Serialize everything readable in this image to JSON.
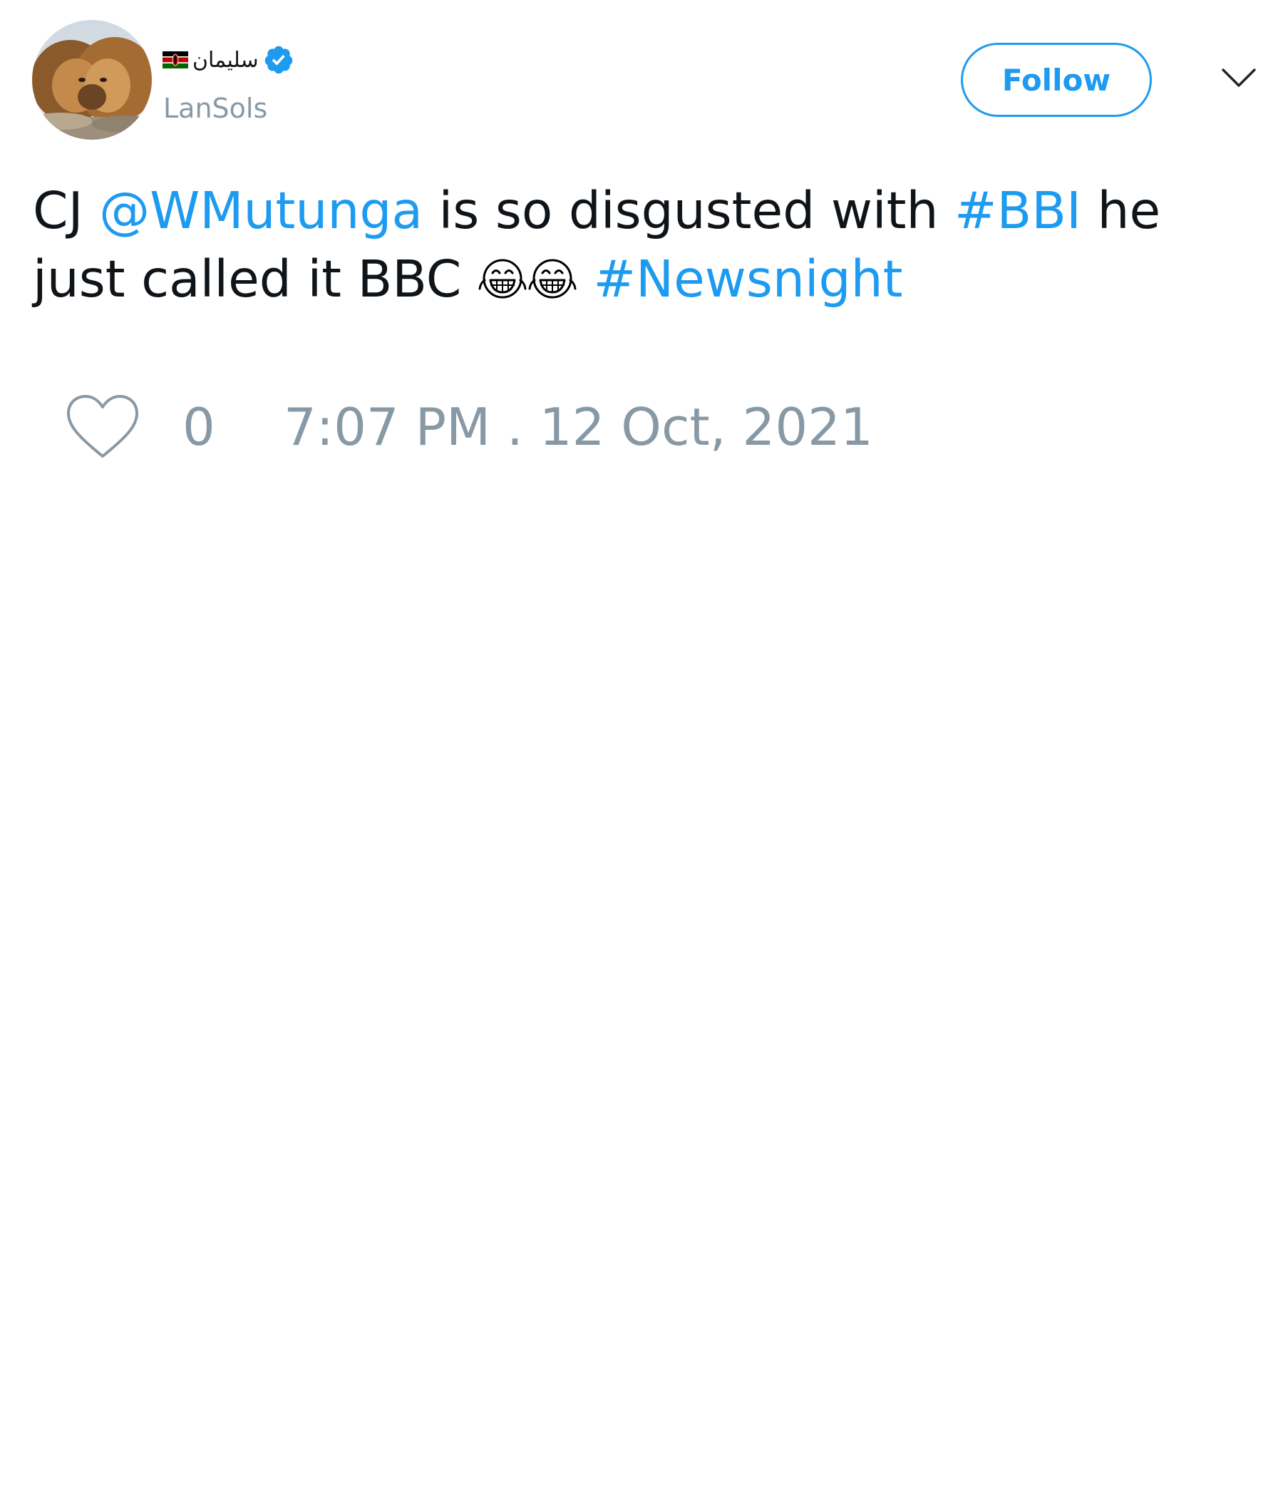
{
  "author": {
    "display_name": "سليمان",
    "handle": "LanSols",
    "verified": true,
    "avatar_icon": "lions-avatar"
  },
  "follow_label": "Follow",
  "tweet": {
    "prefix": "CJ",
    "mention": "@WMutunga",
    "text_1": "is so disgusted with",
    "hashtag_1": "#BBI",
    "text_2": "he just called it BBC",
    "emojis": [
      "face-with-tears-of-joy-icon",
      "face-with-tears-of-joy-icon"
    ],
    "hashtag_2": "#Newsnight"
  },
  "actions": {
    "like_icon": "heart-icon",
    "like_count": "0",
    "timestamp": "7:07 PM . 12 Oct, 2021"
  },
  "colors": {
    "accent": "#1d9bf0",
    "muted": "#8899a6",
    "text": "#0f1419"
  }
}
